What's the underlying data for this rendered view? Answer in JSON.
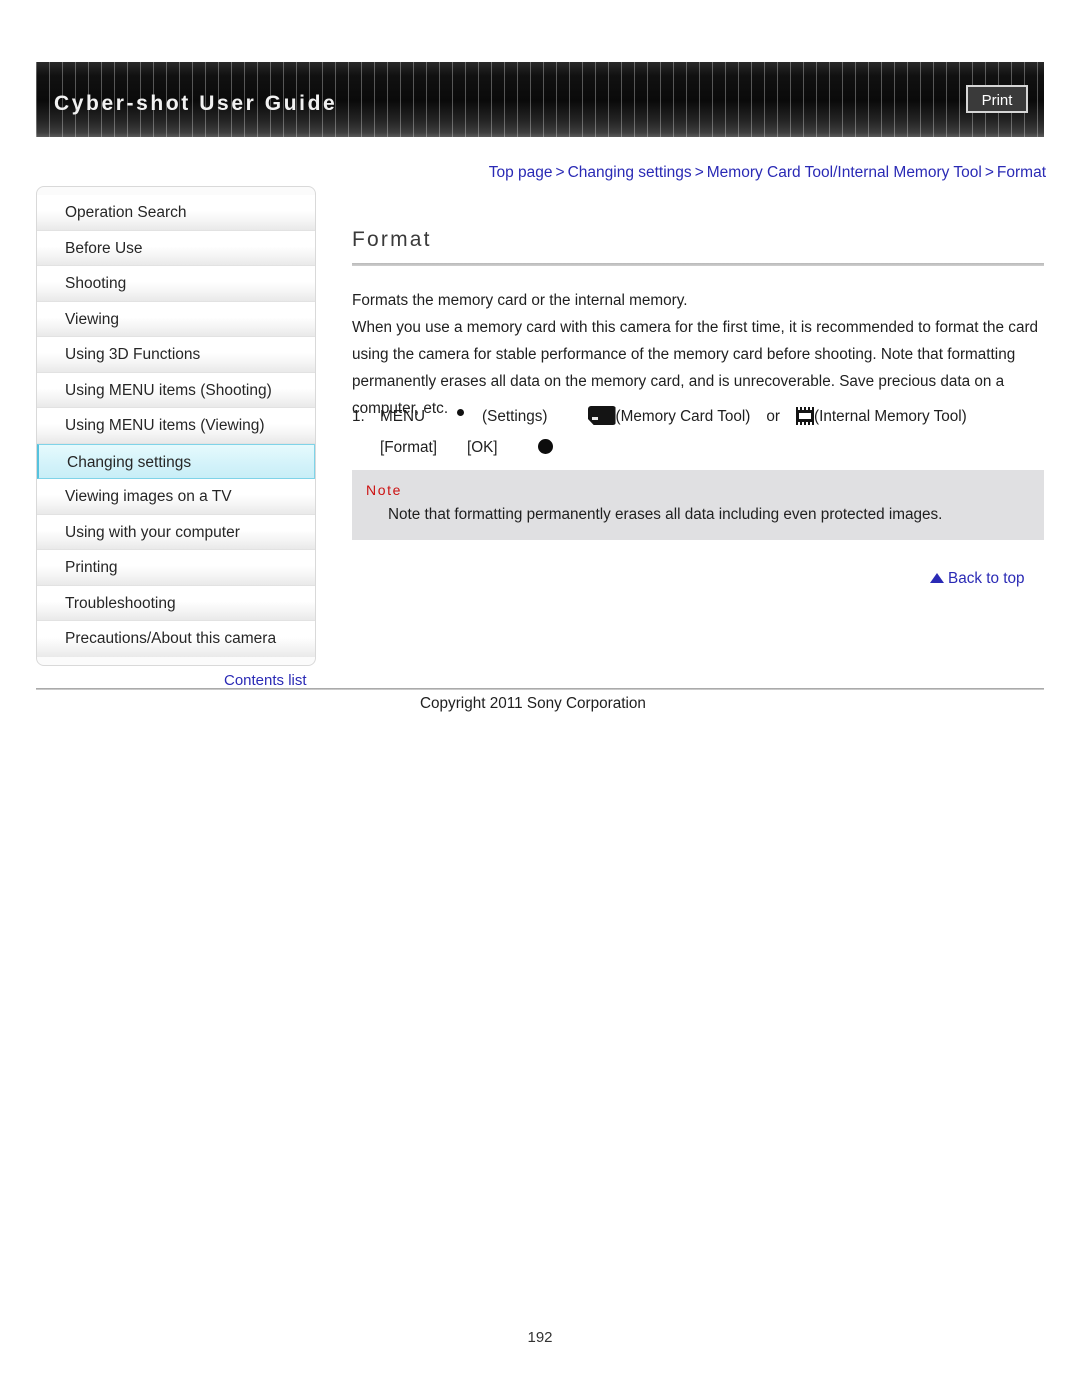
{
  "header": {
    "title": "Cyber-shot User Guide",
    "print_label": "Print"
  },
  "breadcrumb": {
    "separator": ">",
    "items": [
      {
        "label": "Top page"
      },
      {
        "label": "Changing settings"
      },
      {
        "label": "Memory Card Tool/Internal Memory Tool"
      },
      {
        "label": "Format"
      }
    ]
  },
  "sidebar": {
    "items": [
      {
        "label": "Operation Search",
        "active": false
      },
      {
        "label": "Before Use",
        "active": false
      },
      {
        "label": "Shooting",
        "active": false
      },
      {
        "label": "Viewing",
        "active": false
      },
      {
        "label": "Using 3D Functions",
        "active": false
      },
      {
        "label": "Using MENU items (Shooting)",
        "active": false
      },
      {
        "label": "Using MENU items (Viewing)",
        "active": false
      },
      {
        "label": "Changing settings",
        "active": true
      },
      {
        "label": "Viewing images on a TV",
        "active": false
      },
      {
        "label": "Using with your computer",
        "active": false
      },
      {
        "label": "Printing",
        "active": false
      },
      {
        "label": "Troubleshooting",
        "active": false
      },
      {
        "label": "Precautions/About this camera",
        "active": false
      }
    ],
    "contents_list_label": "Contents list"
  },
  "main": {
    "page_title": "Format",
    "intro_line": "Formats the memory card or the internal memory.",
    "body_paragraph": "When you use a memory card with this camera for the first time, it is recommended to format the card using the camera for stable performance of the memory card before shooting. Note that formatting permanently erases all data on the memory card, and is unrecoverable. Save precious data on a computer, etc.",
    "step": {
      "number": "1.",
      "menu_label": "MENU",
      "settings_label": "(Settings)",
      "memory_card_tool_label": "(Memory Card Tool)",
      "or_label": "or",
      "internal_memory_tool_label": "(Internal Memory Tool)",
      "format_label": "[Format]",
      "ok_label": "[OK]"
    },
    "note": {
      "label": "Note",
      "text": "Note that formatting permanently erases all data including even protected images."
    },
    "back_to_top_label": "Back to top"
  },
  "footer": {
    "copyright": "Copyright 2011 Sony Corporation",
    "page_number": "192"
  },
  "colors": {
    "link": "#2a2ab5",
    "note_accent": "#cc1111",
    "active_item": "#c8eef7"
  }
}
